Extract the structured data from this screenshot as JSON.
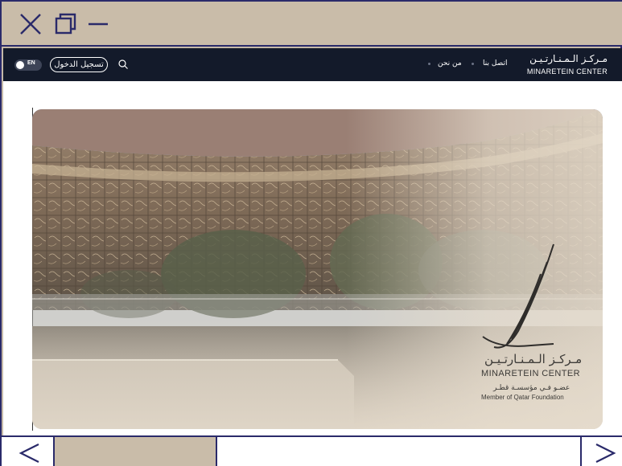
{
  "window": {
    "controls": {
      "close_icon": "close-icon",
      "restore_icon": "restore-icon",
      "minimize_icon": "minimize-icon"
    }
  },
  "header": {
    "language_toggle": {
      "label": "EN",
      "icon": "toggle-switch"
    },
    "login_label": "تسجيل الدخول",
    "search_icon": "search-icon",
    "nav": [
      {
        "label": "اتصل بنا"
      },
      {
        "label": "من نحن"
      }
    ],
    "logo": {
      "arabic": "مـركـز الـمـنـارتـيـن",
      "english": "MINARETEIN CENTER"
    }
  },
  "hero": {
    "image_alt": "building-courtyard-photo",
    "brand": {
      "arabic": "مـركـز الـمـنـارتـيـن",
      "english": "MINARETEIN CENTER",
      "member_arabic": "عضـو فـي مؤسسـة قطـر",
      "member_english": "Member of Qatar Foundation"
    }
  },
  "bottombar": {
    "back_icon": "chevron-left-icon",
    "forward_icon": "chevron-right-icon"
  },
  "colors": {
    "chrome": "#c9bca9",
    "border": "#2a2a6a",
    "header_bg": "#131a2a"
  }
}
